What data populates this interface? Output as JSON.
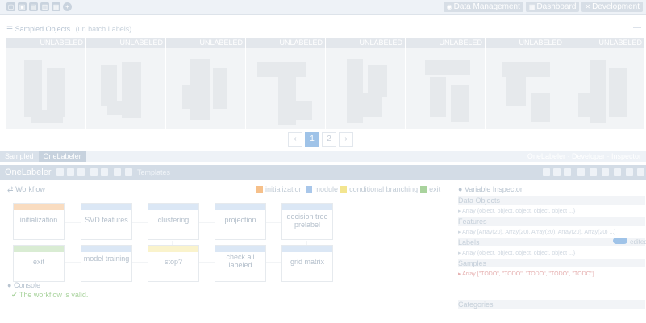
{
  "topbar": {
    "icons": [
      "folder-open-icon",
      "folder-icon",
      "save-icon",
      "trash-icon",
      "export-icon",
      "add-circle-icon"
    ],
    "buttons": [
      {
        "icon": "database-icon",
        "label": "Data Management"
      },
      {
        "icon": "dashboard-icon",
        "label": "Dashboard"
      },
      {
        "icon": "tools-icon",
        "label": "Development"
      }
    ]
  },
  "sampled": {
    "title": "Sampled Objects",
    "subtitle": "(un batch Labels)",
    "thumb_tag": "UNLABELED",
    "thumbs": 8
  },
  "pager": {
    "prev": "‹",
    "pages": [
      "1",
      "2"
    ],
    "active": "1",
    "next": "›"
  },
  "tabstrip": {
    "tabs": [
      "Sampled",
      "OneLabeler"
    ],
    "right_text": "OneLabeler  ·  Developer  ·  Inspector"
  },
  "onelabeler": {
    "title": "OneLabeler",
    "templates": "Templates"
  },
  "workflow": {
    "label": "Workflow",
    "legend": [
      {
        "label": "initialization",
        "color": "#f6c08a"
      },
      {
        "label": "module",
        "color": "#a9c7ea"
      },
      {
        "label": "conditional branching",
        "color": "#f3e58f"
      },
      {
        "label": "exit",
        "color": "#a9d39d"
      }
    ],
    "nodes": [
      {
        "label": "initialization"
      },
      {
        "label": "SVD features"
      },
      {
        "label": "clustering"
      },
      {
        "label": "projection"
      },
      {
        "label": "decision tree prelabel"
      },
      {
        "label": "exit"
      },
      {
        "label": "model training"
      },
      {
        "label": "stop?"
      },
      {
        "label": "check all labeled"
      },
      {
        "label": "grid matrix"
      }
    ]
  },
  "inspector": {
    "title": "Variable Inspector",
    "sections": [
      {
        "label": "Data Objects",
        "values": "▸ Array   {object, object, object, object, object ...}"
      },
      {
        "label": "Features",
        "values": "▸ Array   [Array(20), Array(20), Array(20), Array(20), Array(20) ...]"
      },
      {
        "label": "Labels",
        "values": "▸ Array   {object, object, object, object, object ...}"
      },
      {
        "label": "Samples",
        "values": "▸ Array   [\"TODO\", \"TODO\", \"TODO\", \"TODO\", \"TODO\"] ..."
      },
      {
        "label": "Categories",
        "values": ""
      }
    ],
    "edited_label": "edited"
  },
  "console": {
    "title": "Console",
    "line": "The workflow is valid."
  }
}
